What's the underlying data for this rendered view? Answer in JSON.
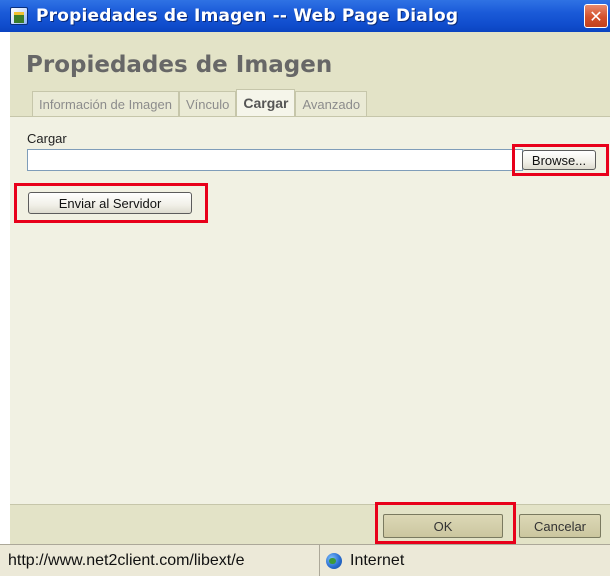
{
  "window": {
    "title": "Propiedades de Imagen -- Web Page Dialog",
    "close_label": "✕"
  },
  "header": {
    "title": "Propiedades de Imagen"
  },
  "tabs": [
    {
      "label": "Información de Imagen",
      "active": false
    },
    {
      "label": "Vínculo",
      "active": false
    },
    {
      "label": "Cargar",
      "active": true
    },
    {
      "label": "Avanzado",
      "active": false
    }
  ],
  "upload": {
    "label": "Cargar",
    "file_value": "",
    "browse_label": "Browse...",
    "send_label": "Enviar al Servidor"
  },
  "footer": {
    "ok_label": "OK",
    "cancel_label": "Cancelar"
  },
  "statusbar": {
    "url": "http://www.net2client.com/libext/e",
    "zone": "Internet"
  },
  "highlight_color": "#e8001a"
}
